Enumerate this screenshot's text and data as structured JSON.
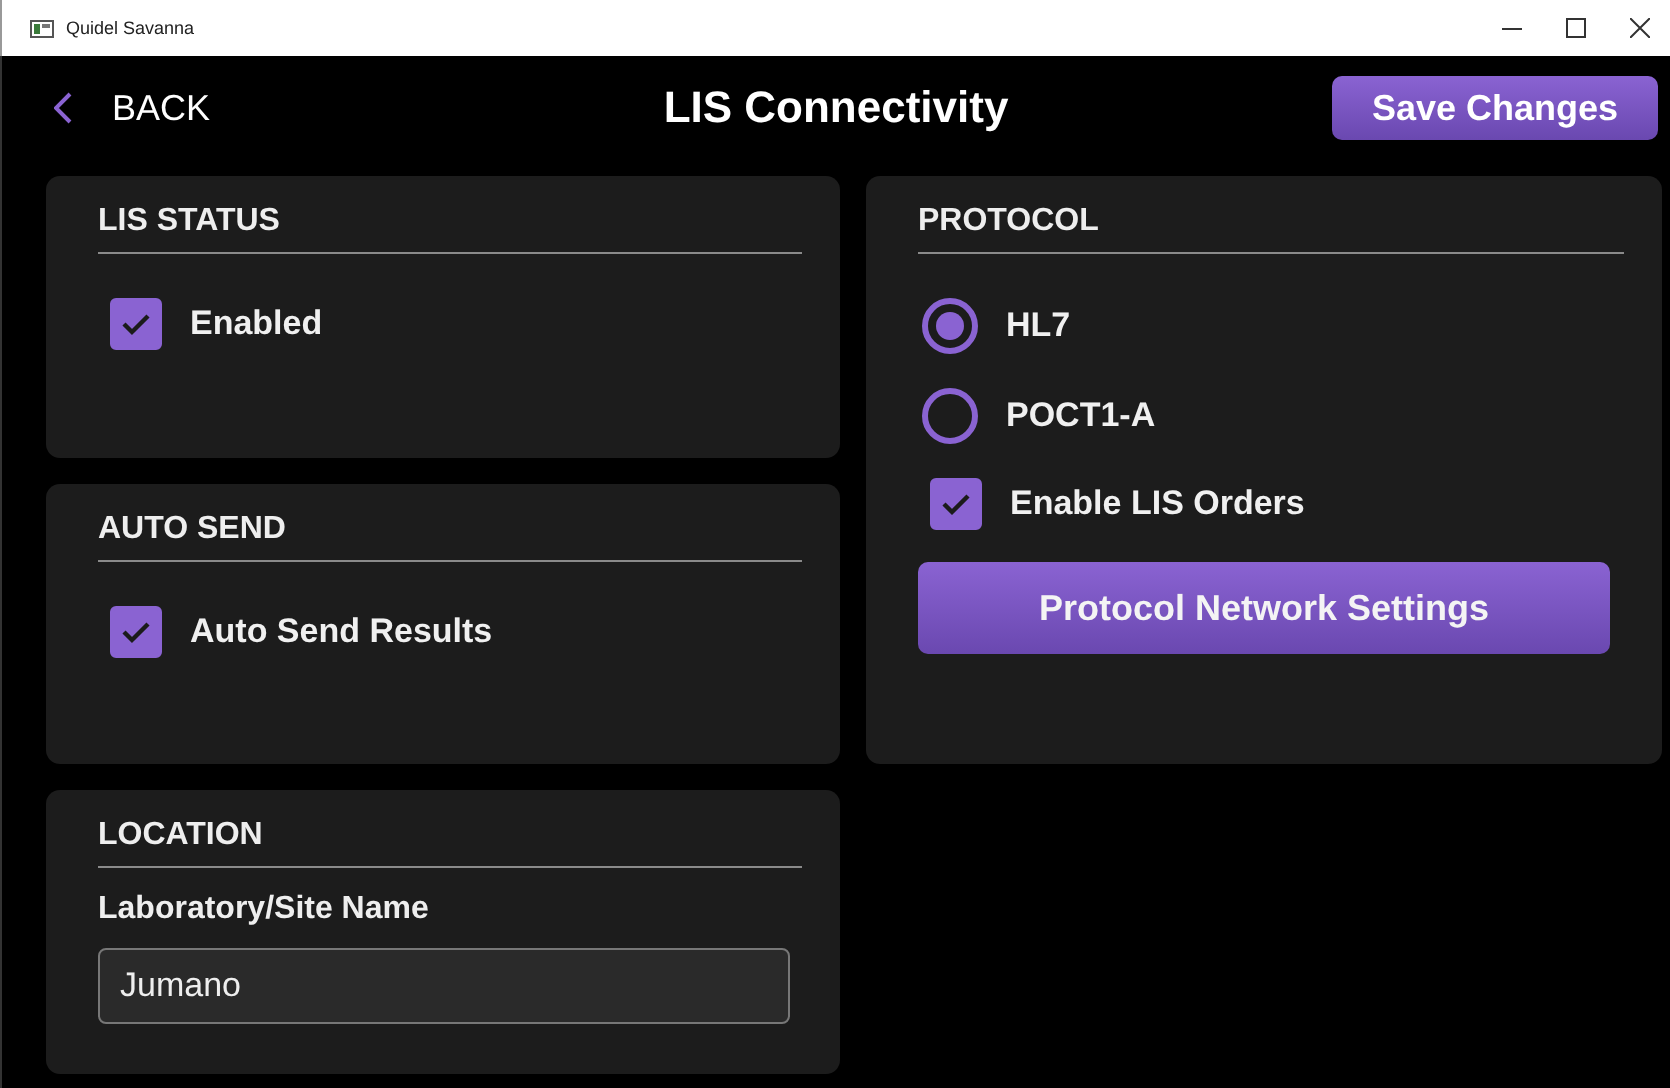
{
  "window": {
    "title": "Quidel Savanna"
  },
  "header": {
    "back_label": "BACK",
    "title": "LIS Connectivity",
    "save_button": "Save Changes"
  },
  "left_panels": [
    {
      "heading": "LIS STATUS",
      "items": [
        {
          "kind": "checkbox",
          "label": "Enabled",
          "checked": true
        }
      ]
    },
    {
      "heading": "AUTO SEND",
      "items": [
        {
          "kind": "checkbox",
          "label": "Auto Send Results",
          "checked": true
        }
      ]
    },
    {
      "heading": "LOCATION",
      "items": [
        {
          "kind": "field",
          "label": "Laboratory/Site Name",
          "value": "Jumano"
        }
      ]
    }
  ],
  "right_panels": [
    {
      "heading": "PROTOCOL",
      "items": [
        {
          "kind": "radio",
          "label": "HL7",
          "selected": true
        },
        {
          "kind": "radio",
          "label": "POCT1-A",
          "selected": false
        },
        {
          "kind": "checkbox",
          "label": "Enable LIS Orders",
          "checked": true
        },
        {
          "kind": "button",
          "label": "Protocol Network Settings"
        }
      ]
    }
  ]
}
